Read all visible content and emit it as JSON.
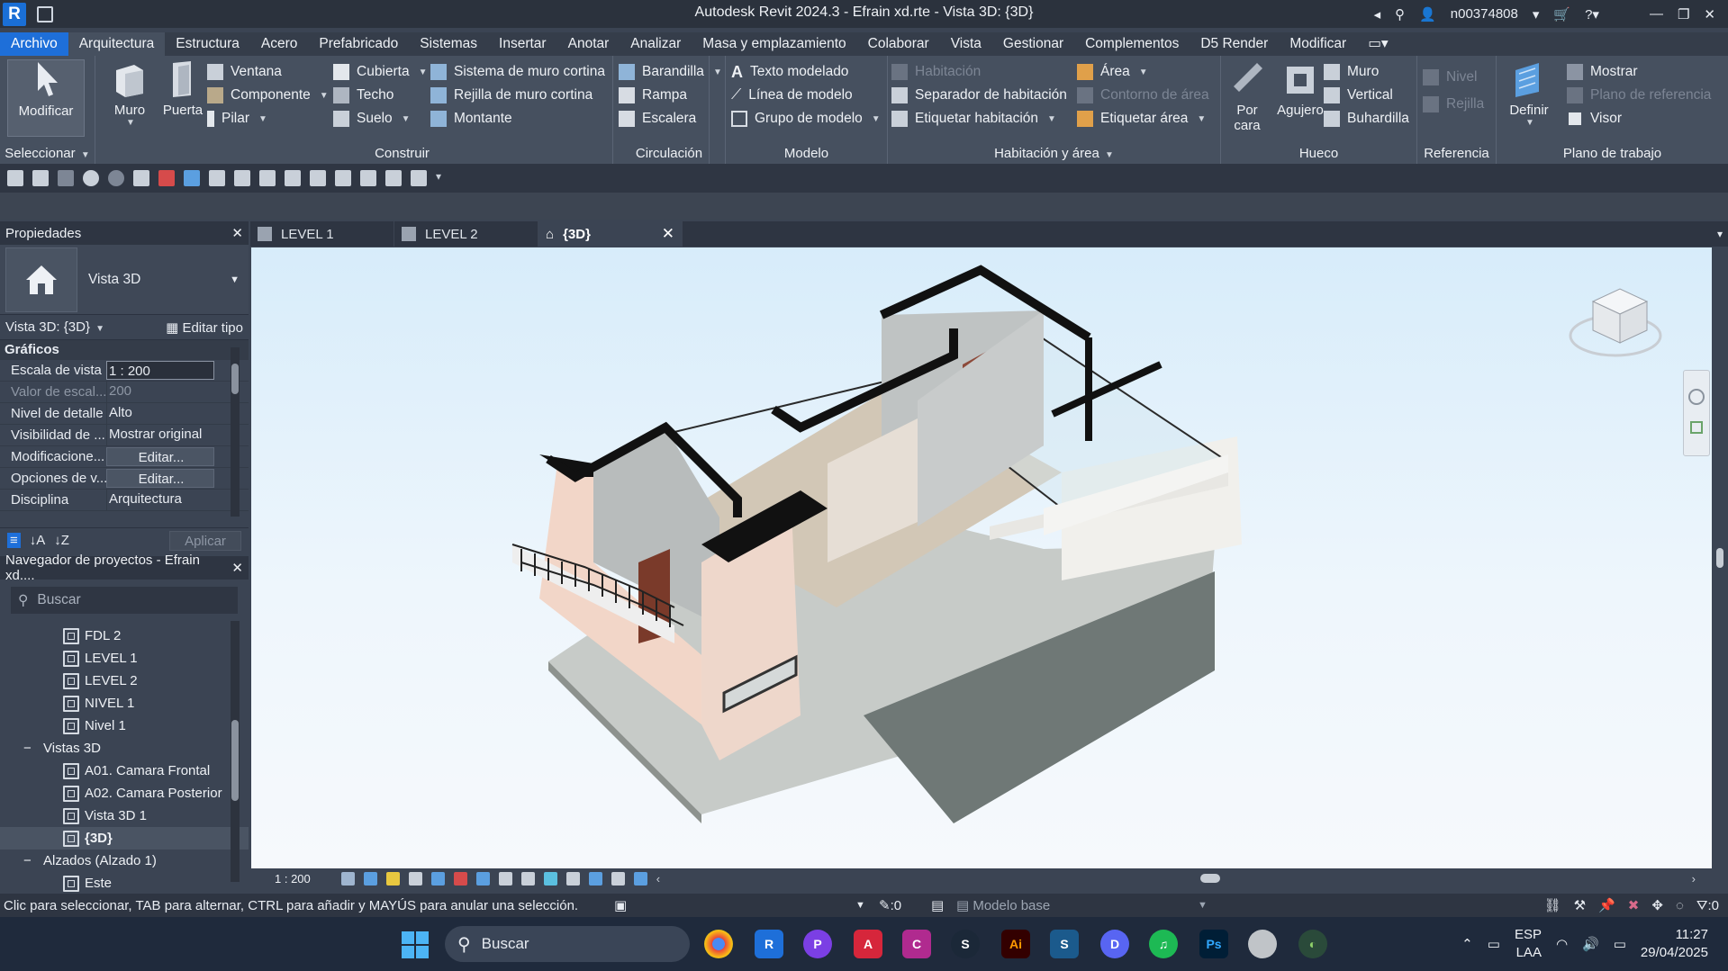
{
  "window": {
    "title": "Autodesk Revit 2024.3 - Efrain xd.rte - Vista 3D: {3D}",
    "user": "n00374808"
  },
  "menu": {
    "tabs": [
      "Archivo",
      "Arquitectura",
      "Estructura",
      "Acero",
      "Prefabricado",
      "Sistemas",
      "Insertar",
      "Anotar",
      "Analizar",
      "Masa y emplazamiento",
      "Colaborar",
      "Vista",
      "Gestionar",
      "Complementos",
      "D5 Render",
      "Modificar"
    ],
    "active": "Arquitectura"
  },
  "ribbon": {
    "select": {
      "modify": "Modificar",
      "label": "Seleccionar"
    },
    "build": {
      "label": "Construir",
      "wall": "Muro",
      "door": "Puerta",
      "window": "Ventana",
      "component": "Componente",
      "column": "Pilar",
      "roof": "Cubierta",
      "ceiling": "Techo",
      "floor": "Suelo",
      "curtain_system": "Sistema de muro cortina",
      "curtain_grid": "Rejilla de muro cortina",
      "mullion": "Montante"
    },
    "circulation": {
      "label": "Circulación",
      "railing": "Barandilla",
      "ramp": "Rampa",
      "stair": "Escalera"
    },
    "model": {
      "label": "Modelo",
      "model_text": "Texto modelado",
      "model_line": "Línea de modelo",
      "model_group": "Grupo de modelo"
    },
    "room": {
      "label": "Habitación y área",
      "room": "Habitación",
      "room_separator": "Separador de habitación",
      "tag_room": "Etiquetar  habitación",
      "area": "Área",
      "area_boundary": "Contorno de área",
      "tag_area": "Etiquetar  área"
    },
    "opening": {
      "label": "Hueco",
      "by_face": "Por",
      "by_face2": "cara",
      "shaft": "Agujero",
      "wall": "Muro",
      "vertical": "Vertical",
      "dormer": "Buhardilla"
    },
    "datum": {
      "label": "Referencia",
      "level": "Nivel",
      "grid": "Rejilla"
    },
    "workplane": {
      "label": "Plano de trabajo",
      "set": "Definir",
      "show": "Mostrar",
      "ref_plane": "Plano de referencia",
      "viewer": "Visor"
    }
  },
  "properties": {
    "title": "Propiedades",
    "type_name": "Vista 3D",
    "filter": "Vista 3D: {3D}",
    "edit_type": "Editar tipo",
    "category": "Gráficos",
    "rows": [
      {
        "name": "Escala de vista",
        "value": "1 : 200"
      },
      {
        "name": "Valor de escal...",
        "value": "200"
      },
      {
        "name": "Nivel de detalle",
        "value": "Alto"
      },
      {
        "name": "Visibilidad de ...",
        "value": "Mostrar original"
      },
      {
        "name": "Modificacione...",
        "value": "Editar..."
      },
      {
        "name": "Opciones de v...",
        "value": "Editar..."
      },
      {
        "name": "Disciplina",
        "value": "Arquitectura"
      }
    ],
    "apply": "Aplicar"
  },
  "browser": {
    "title": "Navegador de proyectos - Efrain xd....",
    "search_placeholder": "Buscar",
    "items": [
      {
        "label": "FDL 2"
      },
      {
        "label": "LEVEL 1"
      },
      {
        "label": "LEVEL 2"
      },
      {
        "label": "NIVEL 1"
      },
      {
        "label": "Nivel 1"
      },
      {
        "label": "Vistas 3D"
      },
      {
        "label": "A01. Camara Frontal"
      },
      {
        "label": "A02. Camara Posterior"
      },
      {
        "label": "Vista 3D 1"
      },
      {
        "label": "{3D}"
      },
      {
        "label": "Alzados (Alzado 1)"
      },
      {
        "label": "Este"
      }
    ]
  },
  "view_tabs": [
    "LEVEL 1",
    "LEVEL 2",
    "{3D}"
  ],
  "view_bar": {
    "scale": "1 : 200"
  },
  "status": {
    "message": "Clic para seleccionar, TAB para alternar, CTRL para añadir y MAYÚS para anular una selección.",
    "worksets": ":0",
    "model": "Modelo base",
    "filter_count": ":0"
  },
  "taskbar": {
    "search": "Buscar",
    "lang1": "ESP",
    "lang2": "LAA",
    "time": "11:27",
    "date": "29/04/2025"
  },
  "colors": {
    "accent": "#1e6fd9",
    "ribbon": "#46505f",
    "panel": "#3b4453"
  }
}
